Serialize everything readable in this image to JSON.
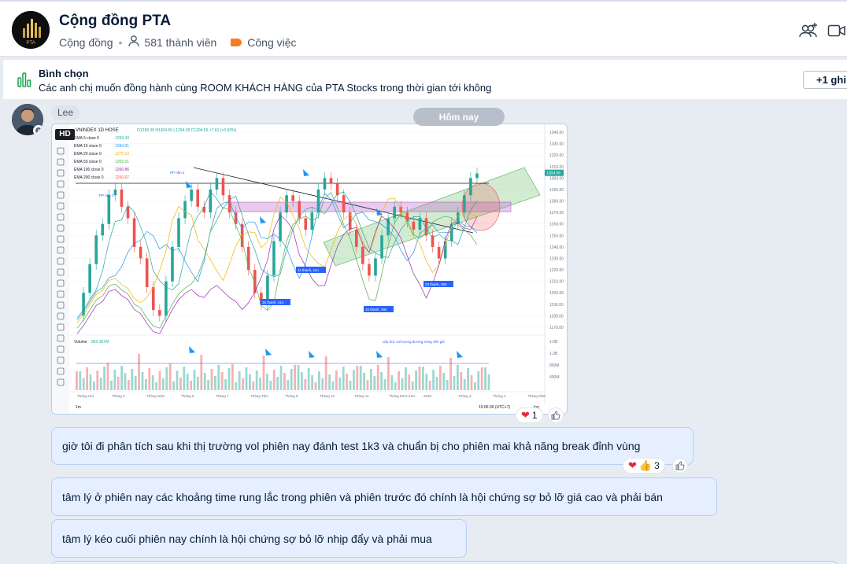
{
  "header": {
    "group_name": "Cộng đồng PTA",
    "type_label": "Cộng đồng",
    "member_count": "581 thành viên",
    "tag_label": "Công việc",
    "tag_color": "#f57c21",
    "logo_text": "PTA",
    "add_member_icon": "add-member-icon",
    "video_icon": "video-call-icon"
  },
  "poll": {
    "title": "Bình chọn",
    "question": "Các anh chị muốn đồng hành cùng ROOM KHÁCH HÀNG  của PTA Stocks trong thời gian tới không",
    "action_label": "+1 ghi",
    "icon": "poll-bar-icon",
    "accent": "#16a34a"
  },
  "chat": {
    "sender": "Lee",
    "date_divider": "Hôm nay",
    "image_message": {
      "hd_badge": "HD",
      "reaction_count": "1",
      "chart": {
        "symbol_label": "VNINDEX  1D  HOSE",
        "ohlc": "O1298.39  H1304.56  L1294.09  C1304.56  +7.61 (+0.60%)",
        "ema": [
          {
            "label": "EMA 5 close 0",
            "value": "1293.43",
            "color": "#26a69a"
          },
          {
            "label": "EMA 10 close 0",
            "value": "1284.01",
            "color": "#2196f3"
          },
          {
            "label": "EMA 20 close 0",
            "value": "1275.10",
            "color": "#f4b400"
          },
          {
            "label": "EMA 50 close 0",
            "value": "1265.01",
            "color": "#4caf50"
          },
          {
            "label": "EMA 100 close 0",
            "value": "1260.86",
            "color": "#9c27b0"
          },
          {
            "label": "EMA 200 close 0",
            "value": "1250.67",
            "color": "#ef5350"
          }
        ],
        "price_ticks": [
          "1340.00",
          "1330.00",
          "1320.00",
          "1310.00",
          "1300.00",
          "1290.00",
          "1280.00",
          "1270.00",
          "1260.00",
          "1250.00",
          "1240.00",
          "1230.00",
          "1220.00",
          "1210.00",
          "1200.00",
          "1190.00",
          "1180.00",
          "1170.00"
        ],
        "last_price": "1304.56",
        "volume_label": "Volume",
        "volume_value": "862.357M",
        "volume_ticks": [
          "1.6B",
          "1.2B",
          "800M",
          "400M"
        ],
        "months": [
          "Tháng Hai",
          "Tháng 4",
          "Tháng Năm",
          "Tháng 6",
          "Tháng 7",
          "Tháng Tám",
          "Tháng 9",
          "Tháng 10",
          "Tháng 11",
          "Tháng Mười Hai",
          "2025",
          "Tháng 3",
          "Tháng 4",
          "Tháng Năm"
        ],
        "time_label": "15:06:36 (UTC+7)",
        "log_label": "log",
        "interval_label": "1m",
        "annotations": [
          "PP nền 1",
          "PP nền 2",
          "11 thanh, 11n",
          "15 thanh, 21n",
          "15 thanh, 29n",
          "23 thanh, 38n",
          "cấu trúc vol tương đương trong nền giá"
        ]
      }
    },
    "messages": [
      {
        "text": "giờ tôi đi phân tích sau khi thị trường vol phiên nay đánh test 1k3 và chuẩn bị cho phiên mai khả năng break đỉnh vùng",
        "reaction_count": "3"
      },
      {
        "text": "tâm lý ở phiên nay các khoảng time rung lắc trong phiên và phiên trước đó chính là hội chứng sợ bỏ lỡ giá cao và phải bán"
      },
      {
        "text": "tâm lý kéo cuối phiên nay chính là hội chứng sợ bỏ lỡ nhịp đẩy và phải mua"
      }
    ]
  }
}
